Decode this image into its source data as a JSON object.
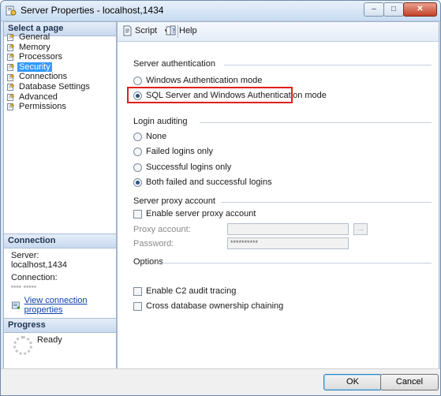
{
  "window": {
    "title": "Server Properties - localhost,1434",
    "minimize_glyph": "–",
    "maximize_glyph": "□",
    "close_glyph": "✕"
  },
  "left_pane": {
    "select_page_header": "Select a page",
    "pages": [
      {
        "label": "General",
        "icon": "page-wrench-icon",
        "selected": false
      },
      {
        "label": "Memory",
        "icon": "page-wrench-icon",
        "selected": false
      },
      {
        "label": "Processors",
        "icon": "page-wrench-icon",
        "selected": false
      },
      {
        "label": "Security",
        "icon": "page-wrench-icon",
        "selected": true
      },
      {
        "label": "Connections",
        "icon": "page-wrench-icon",
        "selected": false
      },
      {
        "label": "Database Settings",
        "icon": "page-wrench-icon",
        "selected": false
      },
      {
        "label": "Advanced",
        "icon": "page-wrench-icon",
        "selected": false
      },
      {
        "label": "Permissions",
        "icon": "page-wrench-icon",
        "selected": false
      }
    ],
    "connection_header": "Connection",
    "server_label": "Server:",
    "server_value": "localhost,1434",
    "connection_label": "Connection:",
    "connection_value": "•••• •••••",
    "view_connection_link": "View connection properties",
    "progress_header": "Progress",
    "progress_status": "Ready"
  },
  "toolbar": {
    "script_label": "Script",
    "help_label": "Help"
  },
  "security": {
    "server_auth_group": "Server authentication",
    "windows_auth_option": "Windows Authentication mode",
    "mixed_auth_option": "SQL Server and Windows Authentication mode",
    "selected_auth": "mixed",
    "login_auditing_group": "Login auditing",
    "audit_none": "None",
    "audit_failed": "Failed logins only",
    "audit_successful": "Successful logins only",
    "audit_both": "Both failed and successful logins",
    "selected_audit": "both",
    "proxy_group": "Server proxy account",
    "enable_proxy_label": "Enable server proxy account",
    "proxy_account_label": "Proxy account:",
    "proxy_account_value": "",
    "password_label": "Password:",
    "password_value": "**********",
    "browse_label": "...",
    "options_group": "Options",
    "c2_audit_label": "Enable C2 audit tracing",
    "cross_db_label": "Cross database ownership chaining"
  },
  "buttons": {
    "ok_label": "OK",
    "cancel_label": "Cancel"
  },
  "colors": {
    "accent_selection": "#3399ff",
    "highlight_border": "#e0201c",
    "window_frame": "#dbe7f6"
  }
}
